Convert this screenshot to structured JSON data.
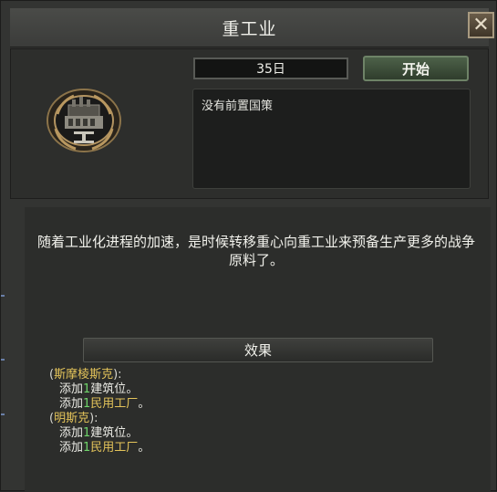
{
  "window": {
    "title": "重工业",
    "close_label": "✕"
  },
  "focus": {
    "duration": "35日",
    "start_label": "开始",
    "prerequisite": "没有前置国策",
    "description": "随着工业化进程的加速，是时候转移重心向重工业来预备生产更多的战争原料了。"
  },
  "effects": {
    "header": "效果",
    "groups": [
      {
        "state": "斯摩棱斯克",
        "lines": [
          {
            "prefix": "添加",
            "amount": "1",
            "item": "建筑位",
            "suffix": "。"
          },
          {
            "prefix": "添加",
            "amount": "1",
            "item": "民用工厂",
            "suffix": "。"
          }
        ]
      },
      {
        "state": "明斯克",
        "lines": [
          {
            "prefix": "添加",
            "amount": "1",
            "item": "建筑位",
            "suffix": "。"
          },
          {
            "prefix": "添加",
            "amount": "1",
            "item": "民用工厂",
            "suffix": "。"
          }
        ]
      }
    ]
  },
  "colors": {
    "state_name": "#e4c45a",
    "amount": "#6fd46a",
    "start_button": "#3f5239"
  },
  "icons": {
    "emblem": "heavy-industry-emblem-icon",
    "close": "close-icon"
  }
}
